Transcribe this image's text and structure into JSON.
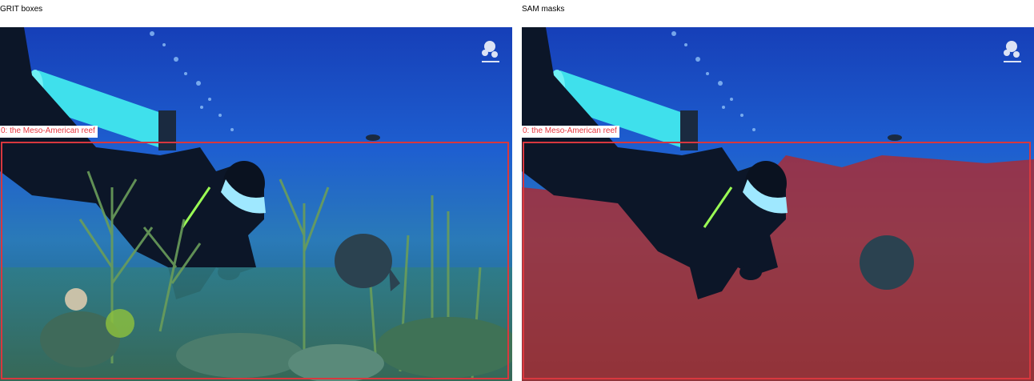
{
  "panels": [
    {
      "title": "GRIT boxes",
      "box_label": "0: the Meso-American reef"
    },
    {
      "title": "SAM masks",
      "box_label": "0: the Meso-American reef"
    }
  ],
  "colors": {
    "box_outline": "#d8383e",
    "label_text": "#e8363e",
    "mask_tint": "#b4282a",
    "water_top": "#1e4fc4",
    "water_bottom": "#2a7fb8"
  },
  "scene_icons": [
    "scuba-diver",
    "air-tank",
    "angelfish",
    "sea-fan",
    "coral",
    "bubbles",
    "watermark-logo"
  ]
}
